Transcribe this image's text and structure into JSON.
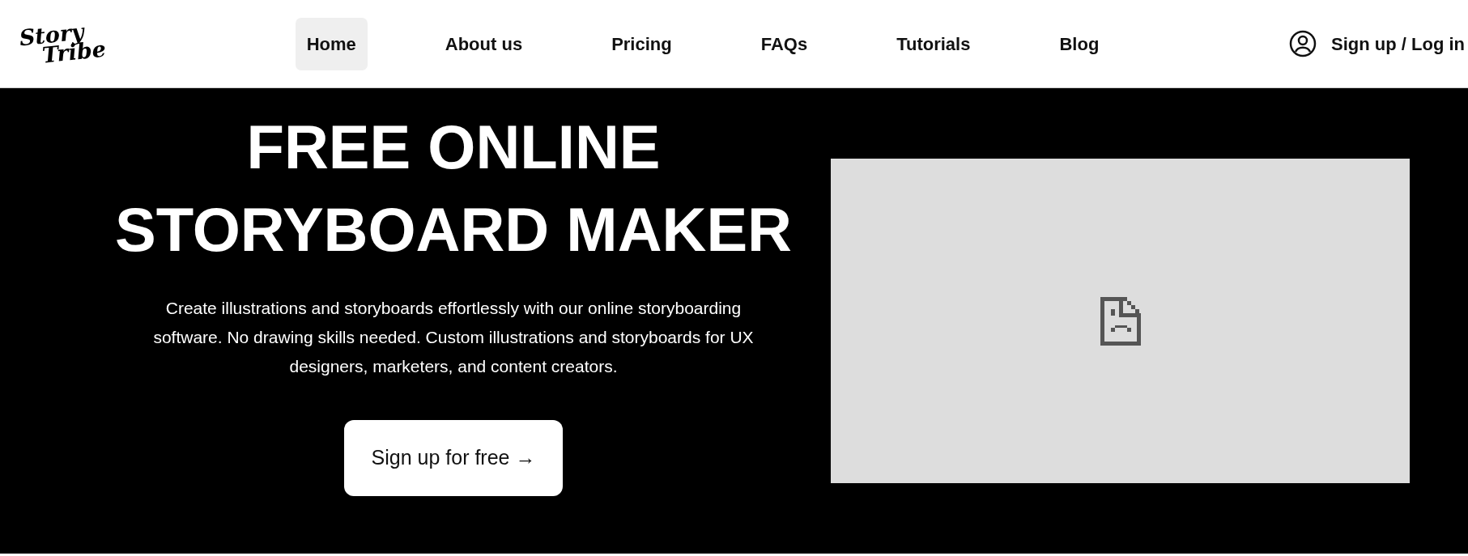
{
  "logo": {
    "lines": [
      "Story",
      "Tribe"
    ]
  },
  "nav": [
    {
      "label": "Home",
      "selected": true
    },
    {
      "label": "About us",
      "selected": false
    },
    {
      "label": "Pricing",
      "selected": false
    },
    {
      "label": "FAQs",
      "selected": false
    },
    {
      "label": "Tutorials",
      "selected": false
    },
    {
      "label": "Blog",
      "selected": false
    }
  ],
  "auth": {
    "label": "Sign up / Log in"
  },
  "hero": {
    "title_lines": [
      "FREE ONLINE",
      "STORYBOARD MAKER"
    ],
    "description": "Create illustrations and storyboards effortlessly with our online storyboarding software. No drawing skills needed. Custom illustrations and storyboards for UX designers, marketers, and content creators.",
    "cta": "Sign up for free →",
    "media": {
      "kind": "broken-image"
    }
  }
}
